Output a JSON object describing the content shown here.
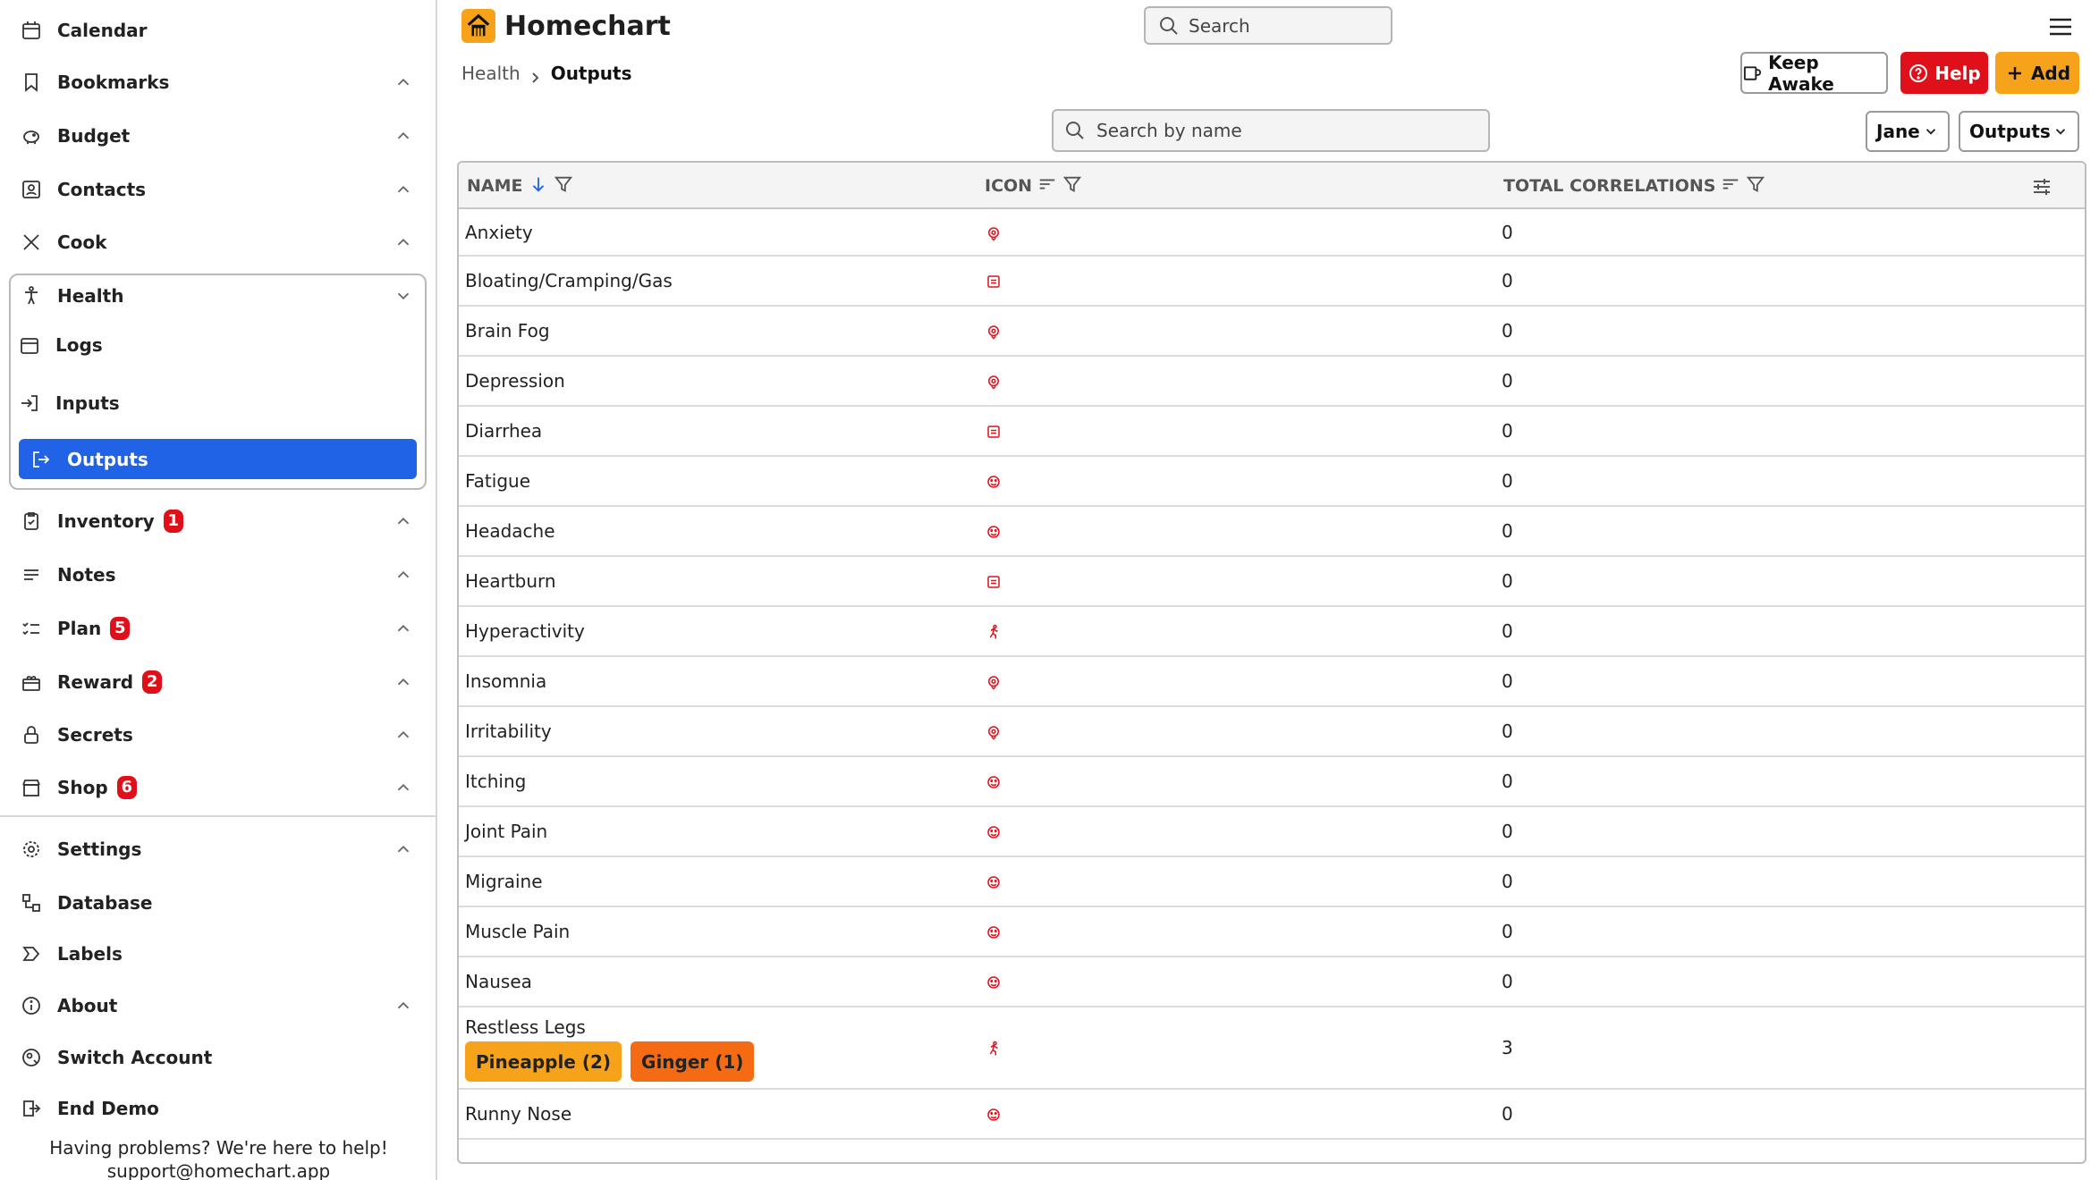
{
  "app": {
    "name": "Homechart",
    "brand_color": "#f7a21b"
  },
  "top_search": {
    "placeholder": "Search"
  },
  "sidebar": {
    "items": [
      {
        "label": "Calendar",
        "icon": "calendar-icon"
      },
      {
        "label": "Bookmarks",
        "icon": "bookmark-icon"
      },
      {
        "label": "Budget",
        "icon": "piggy-bank-icon"
      },
      {
        "label": "Contacts",
        "icon": "contacts-icon"
      },
      {
        "label": "Cook",
        "icon": "utensils-icon"
      },
      {
        "label": "Health",
        "icon": "person-icon"
      },
      {
        "label": "Logs",
        "icon": "calendar-icon"
      },
      {
        "label": "Inputs",
        "icon": "input-icon"
      },
      {
        "label": "Outputs",
        "icon": "output-icon"
      },
      {
        "label": "Inventory",
        "icon": "clipboard-icon",
        "badge": "1"
      },
      {
        "label": "Notes",
        "icon": "notes-icon"
      },
      {
        "label": "Plan",
        "icon": "checklist-icon",
        "badge": "5"
      },
      {
        "label": "Reward",
        "icon": "gift-icon",
        "badge": "2"
      },
      {
        "label": "Secrets",
        "icon": "lock-icon"
      },
      {
        "label": "Shop",
        "icon": "store-icon",
        "badge": "6"
      },
      {
        "label": "Settings",
        "icon": "gear-icon"
      },
      {
        "label": "Database",
        "icon": "database-icon"
      },
      {
        "label": "Labels",
        "icon": "label-icon"
      },
      {
        "label": "About",
        "icon": "info-icon"
      },
      {
        "label": "Switch Account",
        "icon": "switch-account-icon"
      },
      {
        "label": "End Demo",
        "icon": "exit-icon"
      }
    ],
    "help_line1": "Having problems? We're here to help!",
    "help_line2": "support@homechart.app"
  },
  "breadcrumb": {
    "parent": "Health",
    "current": "Outputs"
  },
  "buttons": {
    "keep_awake": "Keep Awake",
    "help": "Help",
    "add": "Add"
  },
  "table_search": {
    "placeholder": "Search by name"
  },
  "filters": {
    "person": "Jane",
    "view": "Outputs"
  },
  "table": {
    "columns": [
      "NAME",
      "ICON",
      "TOTAL CORRELATIONS"
    ],
    "rows": [
      {
        "name": "Anxiety",
        "icon": "head-icon",
        "total": "0"
      },
      {
        "name": "Bloating/Cramping/Gas",
        "icon": "stomach-icon",
        "total": "0"
      },
      {
        "name": "Brain Fog",
        "icon": "head-icon",
        "total": "0"
      },
      {
        "name": "Depression",
        "icon": "head-icon",
        "total": "0"
      },
      {
        "name": "Diarrhea",
        "icon": "stomach-icon",
        "total": "0"
      },
      {
        "name": "Fatigue",
        "icon": "face-icon",
        "total": "0"
      },
      {
        "name": "Headache",
        "icon": "face-icon",
        "total": "0"
      },
      {
        "name": "Heartburn",
        "icon": "stomach-icon",
        "total": "0"
      },
      {
        "name": "Hyperactivity",
        "icon": "running-icon",
        "total": "0"
      },
      {
        "name": "Insomnia",
        "icon": "head-icon",
        "total": "0"
      },
      {
        "name": "Irritability",
        "icon": "head-icon",
        "total": "0"
      },
      {
        "name": "Itching",
        "icon": "face-icon",
        "total": "0"
      },
      {
        "name": "Joint Pain",
        "icon": "face-icon",
        "total": "0"
      },
      {
        "name": "Migraine",
        "icon": "face-icon",
        "total": "0"
      },
      {
        "name": "Muscle Pain",
        "icon": "face-icon",
        "total": "0"
      },
      {
        "name": "Nausea",
        "icon": "face-icon",
        "total": "0"
      },
      {
        "name": "Restless Legs",
        "icon": "running-icon",
        "total": "3",
        "tags": [
          "Pineapple (2)",
          "Ginger (1)"
        ]
      },
      {
        "name": "Runny Nose",
        "icon": "face-icon",
        "total": "0"
      }
    ]
  }
}
